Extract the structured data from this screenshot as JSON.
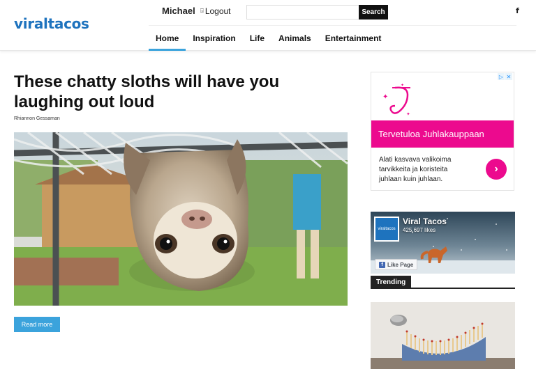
{
  "header": {
    "logo": "viraltacos",
    "user_name": "Michael",
    "logout_label": "Logout",
    "search_placeholder": "",
    "search_button": "Search",
    "social_icon": "facebook-icon"
  },
  "nav": {
    "items": [
      {
        "label": "Home",
        "active": true
      },
      {
        "label": "Inspiration",
        "active": false
      },
      {
        "label": "Life",
        "active": false
      },
      {
        "label": "Animals",
        "active": false
      },
      {
        "label": "Entertainment",
        "active": false
      }
    ]
  },
  "article": {
    "title": "These chatty sloths will have you laughing out loud",
    "author": "Rhiannon Gessaman",
    "read_more": "Read more"
  },
  "ad": {
    "headline": "Tervetuloa Juhlakauppaan",
    "body": "Alati kasvava valikoima tarvikkeita ja koristeita juhlaan kuin juhlaan."
  },
  "facebook_widget": {
    "page_name": "Viral Tacos",
    "likes": "425,697 likes",
    "avatar_text": "viraltacos",
    "like_button": "Like Page"
  },
  "sidebar": {
    "trending_label": "Trending"
  },
  "colors": {
    "brand": "#1e73be",
    "accent": "#3ba3dc",
    "ad_pink": "#ec0a8e"
  }
}
